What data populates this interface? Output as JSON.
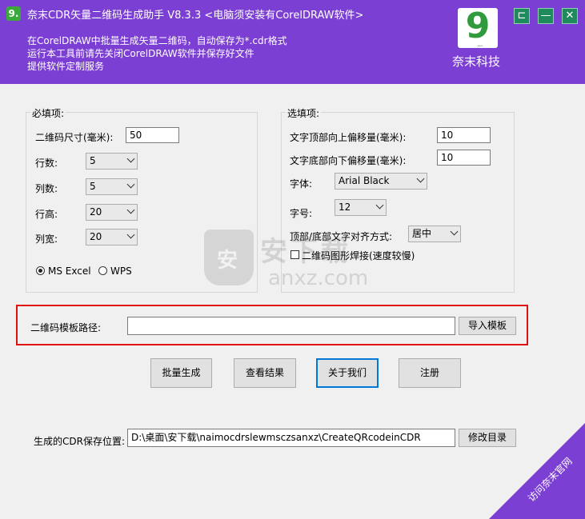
{
  "header": {
    "app_icon": "9.",
    "title": "奈末CDR矢量二维码生成助手  V8.3.3   <电脑须安装有CorelDRAW软件>",
    "desc_lines": [
      "在CorelDRAW中批量生成矢量二维码，自动保存为*.cdr格式",
      "运行本工具前请先关闭CorelDRAW软件并保存好文件",
      "提供软件定制服务"
    ],
    "logo_digit": "9",
    "logo_dots": "...",
    "brand": "奈末科技",
    "window_buttons": {
      "pin": "⊏",
      "minimize": "—",
      "close": "✕"
    }
  },
  "required": {
    "title": "必填项:",
    "size_label": "二维码尺寸(毫米):",
    "size_value": "50",
    "rows_label": "行数:",
    "rows_value": "5",
    "cols_label": "列数:",
    "cols_value": "5",
    "row_height_label": "行高:",
    "row_height_value": "20",
    "col_width_label": "列宽:",
    "col_width_value": "20",
    "radio_excel": "MS Excel",
    "radio_wps": "WPS"
  },
  "optional": {
    "title": "选填项:",
    "top_offset_label": "文字顶部向上偏移量(毫米):",
    "top_offset_value": "10",
    "bottom_offset_label": "文字底部向下偏移量(毫米):",
    "bottom_offset_value": "10",
    "font_label": "字体:",
    "font_value": "Arial Black",
    "font_size_label": "字号:",
    "font_size_value": "12",
    "align_label": "顶部/底部文字对齐方式:",
    "align_value": "居中",
    "crop_label": "二维码图形焊接(速度较慢)"
  },
  "template": {
    "label": "二维码模板路径:",
    "value": "",
    "import_button": "导入模板"
  },
  "actions": {
    "batch": "批量生成",
    "view": "查看结果",
    "about": "关于我们",
    "register": "注册"
  },
  "save": {
    "label": "生成的CDR保存位置:",
    "path": "D:\\桌面\\安下载\\naimocdrslewmsczsanxz\\CreateQRcodeinCDR",
    "change_button": "修改目录"
  },
  "watermark": {
    "shield": "安",
    "text": "安下载",
    "sub": "anxz.com"
  },
  "corner_link": "访问奈末官网",
  "colors": {
    "header_bg": "#7c3fd4",
    "highlight_border": "#e01010",
    "logo_green": "#2f9b3c",
    "window_btn": "#1f8a5c"
  }
}
